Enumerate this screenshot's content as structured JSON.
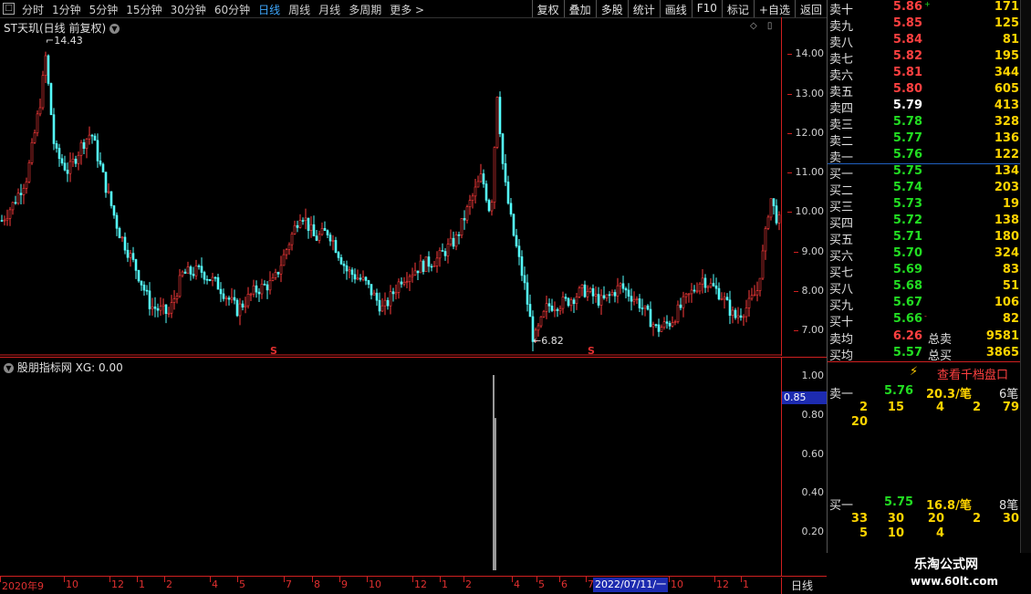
{
  "toolbar": {
    "periods": [
      "分时",
      "1分钟",
      "5分钟",
      "15分钟",
      "30分钟",
      "60分钟",
      "日线",
      "周线",
      "月线",
      "多周期",
      "更多 >"
    ],
    "active_period": "日线",
    "actions": [
      "复权",
      "叠加",
      "多股",
      "统计",
      "画线",
      "F10",
      "标记",
      "+自选",
      "返回"
    ]
  },
  "main_chart": {
    "title": "ST天玑(日线 前复权)",
    "high_label": "14.43",
    "low_label": "6.82",
    "s_mark": "S",
    "axis_ticks": [
      "14.00",
      "13.00",
      "12.00",
      "11.00",
      "10.00",
      "9.00",
      "8.00",
      "7.00"
    ]
  },
  "indicator": {
    "title": "股朋指标网 XG: 0.00",
    "cursor_value": "0.85",
    "axis_ticks": [
      "1.00",
      "0.80",
      "0.60",
      "0.40",
      "0.20"
    ]
  },
  "date_axis": {
    "labels": [
      "2020年9",
      "10",
      "12",
      "1",
      "2",
      "4",
      "5",
      "7",
      "8",
      "9",
      "10",
      "12",
      "1",
      "2",
      "4",
      "5",
      "6",
      "7",
      "10",
      "12",
      "1"
    ],
    "highlight": "2022/07/11/一",
    "period": "日线"
  },
  "order_book": {
    "sell": [
      {
        "label": "卖十",
        "price": "5.86",
        "vol": "171",
        "mark": "+"
      },
      {
        "label": "卖九",
        "price": "5.85",
        "vol": "125"
      },
      {
        "label": "卖八",
        "price": "5.84",
        "vol": "81"
      },
      {
        "label": "卖七",
        "price": "5.82",
        "vol": "195"
      },
      {
        "label": "卖六",
        "price": "5.81",
        "vol": "344"
      },
      {
        "label": "卖五",
        "price": "5.80",
        "vol": "605"
      },
      {
        "label": "卖四",
        "price": "5.79",
        "vol": "413"
      },
      {
        "label": "卖三",
        "price": "5.78",
        "vol": "328"
      },
      {
        "label": "卖二",
        "price": "5.77",
        "vol": "136"
      },
      {
        "label": "卖一",
        "price": "5.76",
        "vol": "122"
      }
    ],
    "buy": [
      {
        "label": "买一",
        "price": "5.75",
        "vol": "134"
      },
      {
        "label": "买二",
        "price": "5.74",
        "vol": "203"
      },
      {
        "label": "买三",
        "price": "5.73",
        "vol": "19"
      },
      {
        "label": "买四",
        "price": "5.72",
        "vol": "138"
      },
      {
        "label": "买五",
        "price": "5.71",
        "vol": "180"
      },
      {
        "label": "买六",
        "price": "5.70",
        "vol": "324"
      },
      {
        "label": "买七",
        "price": "5.69",
        "vol": "83"
      },
      {
        "label": "买八",
        "price": "5.68",
        "vol": "51"
      },
      {
        "label": "买九",
        "price": "5.67",
        "vol": "106"
      },
      {
        "label": "买十",
        "price": "5.66",
        "vol": "82",
        "mark": "-"
      }
    ],
    "avg_sell": {
      "label": "卖均",
      "price": "6.26",
      "label2": "总卖",
      "vol": "9581"
    },
    "avg_buy": {
      "label": "买均",
      "price": "5.57",
      "label2": "总买",
      "vol": "3865"
    },
    "qianpan_button": "查看千档盘口",
    "sell1": {
      "label": "卖一",
      "price": "5.76",
      "per": "20.3/笔",
      "count": "6笔",
      "queue1": [
        "2",
        "15",
        "4",
        "2",
        "79"
      ],
      "queue2": [
        "20"
      ]
    },
    "buy1": {
      "label": "买一",
      "price": "5.75",
      "per": "16.8/笔",
      "count": "8笔",
      "queue1": [
        "33",
        "30",
        "20",
        "2",
        "30"
      ],
      "queue2": [
        "5",
        "10",
        "4"
      ]
    }
  },
  "logo": {
    "title": "乐淘公式网",
    "url": "www.60lt.com"
  },
  "colors": {
    "up": "#ff3b3b",
    "down": "#54ffff",
    "buy_price": "#22dd22",
    "sell_price": "#ff4040",
    "neutral_price": "#ffffff",
    "volume": "#ffd400"
  }
}
